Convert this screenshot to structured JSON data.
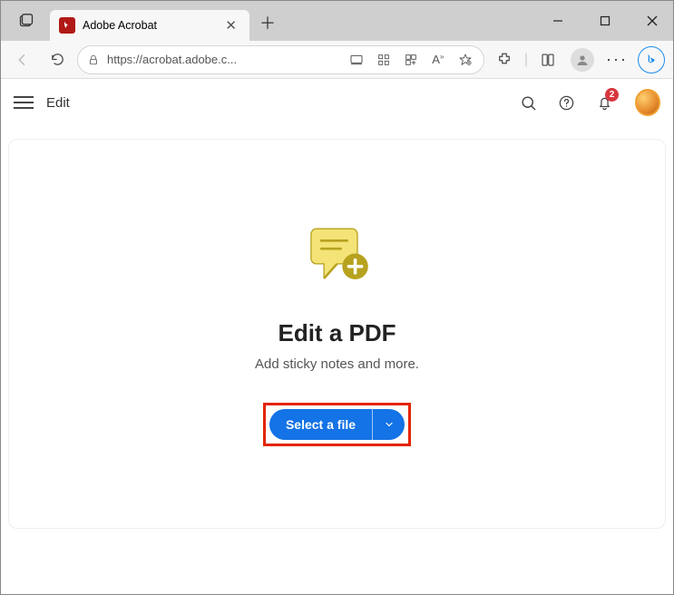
{
  "browser": {
    "tab_title": "Adobe Acrobat",
    "url": "https://acrobat.adobe.c..."
  },
  "header": {
    "page_label": "Edit",
    "notification_count": "2"
  },
  "card": {
    "heading": "Edit a PDF",
    "subheading": "Add sticky notes and more.",
    "select_button_label": "Select a file"
  }
}
